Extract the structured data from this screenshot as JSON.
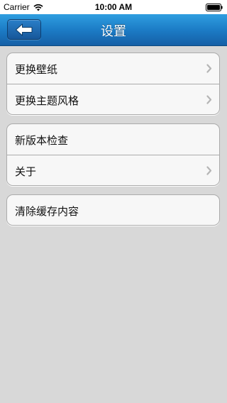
{
  "status_bar": {
    "carrier": "Carrier",
    "time": "10:00 AM",
    "wifi_icon": "wifi-icon",
    "battery_icon": "battery-icon"
  },
  "nav": {
    "title": "设置",
    "back_icon": "arrow-left-icon"
  },
  "groups": [
    {
      "items": [
        {
          "label": "更换壁纸",
          "has_chevron": true
        },
        {
          "label": "更换主题风格",
          "has_chevron": true
        }
      ]
    },
    {
      "items": [
        {
          "label": "新版本检查",
          "has_chevron": false
        },
        {
          "label": "关于",
          "has_chevron": true
        }
      ]
    },
    {
      "items": [
        {
          "label": "清除缓存内容",
          "has_chevron": false
        }
      ]
    }
  ],
  "colors": {
    "background": "#d8d8d8",
    "nav_top": "#2f9ee0",
    "nav_bottom": "#155fa6",
    "cell_bg": "#f7f7f7",
    "separator": "#ababab",
    "chevron": "#b5b5b5"
  }
}
